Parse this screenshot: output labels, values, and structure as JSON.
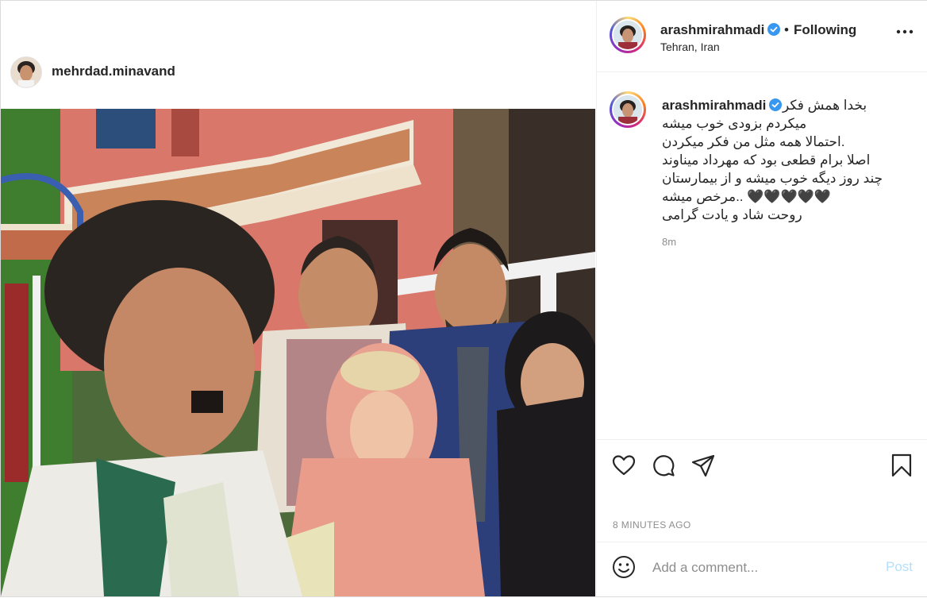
{
  "media": {
    "tagged_username": "mehrdad.minavand"
  },
  "post_header": {
    "username": "arashmirahmadi",
    "separator": "•",
    "follow_label": "Following",
    "location": "Tehran, Iran"
  },
  "caption": {
    "username": "arashmirahmadi",
    "lines": [
      "بخدا همش فکر",
      "میکردم بزودی خوب میشه",
      "احتمالا همه مثل من فکر میکردن.",
      "اصلا برام قطعی بود که مهرداد میناوند",
      "چند روز دیگه خوب میشه و از بیمارستان",
      "مرخص میشه.. 🖤🖤🖤🖤🖤",
      "روحت شاد و یادت گرامی"
    ],
    "relative_time": "8m"
  },
  "actions": {
    "timestamp": "8 MINUTES AGO",
    "comment_placeholder": "Add a comment...",
    "post_label": "Post"
  },
  "colors": {
    "verified": "#3897f0",
    "post_button_disabled": "#b2dffc",
    "muted_text": "#8e8e8e"
  }
}
